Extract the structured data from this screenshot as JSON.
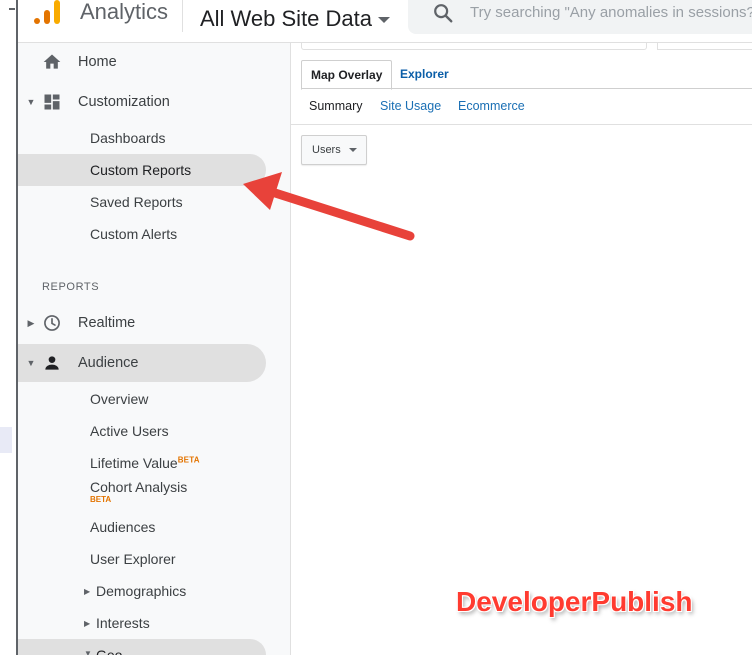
{
  "app": {
    "name": "Analytics",
    "account": "All Web Site Data"
  },
  "search": {
    "placeholder": "Try searching \"Any anomalies in sessions?\""
  },
  "sidebar": {
    "home": "Home",
    "customization": {
      "label": "Customization",
      "items": [
        "Dashboards",
        "Custom Reports",
        "Saved Reports",
        "Custom Alerts"
      ]
    },
    "reports_heading": "REPORTS",
    "realtime": "Realtime",
    "audience": {
      "label": "Audience",
      "items": {
        "overview": "Overview",
        "active_users": "Active Users",
        "lifetime_value": "Lifetime Value",
        "lifetime_value_badge": "BETA",
        "cohort_analysis": "Cohort Analysis",
        "cohort_analysis_badge": "BETA",
        "audiences": "Audiences",
        "user_explorer": "User Explorer",
        "demographics": "Demographics",
        "interests": "Interests"
      }
    },
    "geo": "Geo"
  },
  "content": {
    "tabs": [
      "Map Overlay",
      "Explorer"
    ],
    "subtabs": [
      "Summary",
      "Site Usage",
      "Ecommerce"
    ],
    "metric_select": "Users"
  },
  "watermark": "DeveloperPublish",
  "colors": {
    "accent_arrow": "#e8423a",
    "link": "#1a6fb4",
    "active_row": "#e0e0e0",
    "sidebar_bg": "#f8f9fa"
  },
  "icons": [
    "analytics-logo-icon",
    "search-icon",
    "home-icon",
    "customization-grid-icon",
    "clock-icon",
    "person-icon"
  ]
}
